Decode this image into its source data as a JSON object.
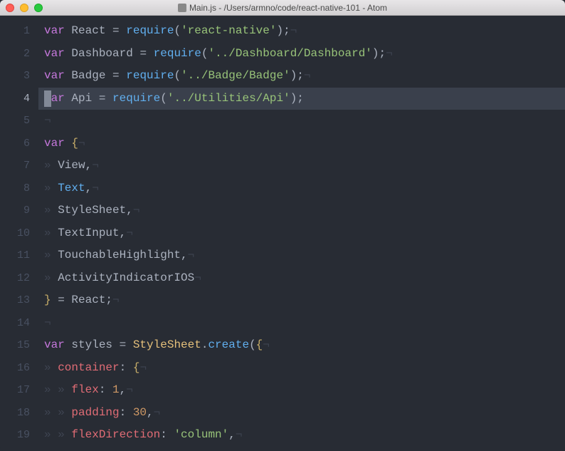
{
  "window": {
    "title": "Main.js - /Users/armno/code/react-native-101 - Atom"
  },
  "gutter": {
    "active_line": 4,
    "lines": [
      "1",
      "2",
      "3",
      "4",
      "5",
      "6",
      "7",
      "8",
      "9",
      "10",
      "11",
      "12",
      "13",
      "14",
      "15",
      "16",
      "17",
      "18",
      "19"
    ]
  },
  "code": {
    "lines": [
      {
        "n": 1,
        "t": [
          [
            "kw",
            "var"
          ],
          [
            "punct",
            " React "
          ],
          [
            "punct",
            "= "
          ],
          [
            "func",
            "require"
          ],
          [
            "punct",
            "("
          ],
          [
            "str",
            "'react-native'"
          ],
          [
            "punct",
            ");"
          ],
          [
            "invisible",
            "¬"
          ]
        ]
      },
      {
        "n": 2,
        "t": [
          [
            "kw",
            "var"
          ],
          [
            "punct",
            " Dashboard "
          ],
          [
            "punct",
            "= "
          ],
          [
            "func",
            "require"
          ],
          [
            "punct",
            "("
          ],
          [
            "str",
            "'../Dashboard/Dashboard'"
          ],
          [
            "punct",
            ");"
          ],
          [
            "invisible",
            "¬"
          ]
        ]
      },
      {
        "n": 3,
        "t": [
          [
            "kw",
            "var"
          ],
          [
            "punct",
            " Badge "
          ],
          [
            "punct",
            "= "
          ],
          [
            "func",
            "require"
          ],
          [
            "punct",
            "("
          ],
          [
            "str",
            "'../Badge/Badge'"
          ],
          [
            "punct",
            ");"
          ],
          [
            "invisible",
            "¬"
          ]
        ]
      },
      {
        "n": 4,
        "highlight": true,
        "cursor": true,
        "t": [
          [
            "kw",
            "var"
          ],
          [
            "punct",
            " Api "
          ],
          [
            "punct",
            "= "
          ],
          [
            "func",
            "require"
          ],
          [
            "punct",
            "("
          ],
          [
            "str",
            "'../Utilities/Api'"
          ],
          [
            "punct",
            ");"
          ]
        ]
      },
      {
        "n": 5,
        "t": [
          [
            "invisible",
            "¬"
          ]
        ]
      },
      {
        "n": 6,
        "t": [
          [
            "kw",
            "var"
          ],
          [
            "punct",
            " "
          ],
          [
            "brace",
            "{"
          ],
          [
            "invisible",
            "¬"
          ]
        ]
      },
      {
        "n": 7,
        "t": [
          [
            "invisible",
            "» "
          ],
          [
            "punct",
            "View,"
          ],
          [
            "invisible",
            "¬"
          ]
        ]
      },
      {
        "n": 8,
        "t": [
          [
            "invisible",
            "» "
          ],
          [
            "prop-blue",
            "Text"
          ],
          [
            "punct",
            ","
          ],
          [
            "invisible",
            "¬"
          ]
        ]
      },
      {
        "n": 9,
        "t": [
          [
            "invisible",
            "» "
          ],
          [
            "punct",
            "StyleSheet,"
          ],
          [
            "invisible",
            "¬"
          ]
        ]
      },
      {
        "n": 10,
        "t": [
          [
            "invisible",
            "» "
          ],
          [
            "punct",
            "TextInput,"
          ],
          [
            "invisible",
            "¬"
          ]
        ]
      },
      {
        "n": 11,
        "t": [
          [
            "invisible",
            "» "
          ],
          [
            "punct",
            "TouchableHighlight,"
          ],
          [
            "invisible",
            "¬"
          ]
        ]
      },
      {
        "n": 12,
        "t": [
          [
            "invisible",
            "» "
          ],
          [
            "punct",
            "ActivityIndicatorIOS"
          ],
          [
            "invisible",
            "¬"
          ]
        ]
      },
      {
        "n": 13,
        "t": [
          [
            "brace",
            "}"
          ],
          [
            "punct",
            " = React;"
          ],
          [
            "invisible",
            "¬"
          ]
        ]
      },
      {
        "n": 14,
        "t": [
          [
            "invisible",
            "¬"
          ]
        ]
      },
      {
        "n": 15,
        "t": [
          [
            "kw",
            "var"
          ],
          [
            "punct",
            " styles "
          ],
          [
            "punct",
            "= "
          ],
          [
            "styles-name",
            "StyleSheet"
          ],
          [
            "punct",
            "."
          ],
          [
            "func",
            "create"
          ],
          [
            "punct",
            "("
          ],
          [
            "brace",
            "{"
          ],
          [
            "invisible",
            "¬"
          ]
        ]
      },
      {
        "n": 16,
        "t": [
          [
            "invisible",
            "» "
          ],
          [
            "prop",
            "container"
          ],
          [
            "punct",
            ": "
          ],
          [
            "brace",
            "{"
          ],
          [
            "invisible",
            "¬"
          ]
        ]
      },
      {
        "n": 17,
        "t": [
          [
            "invisible",
            "» » "
          ],
          [
            "prop",
            "flex"
          ],
          [
            "punct",
            ": "
          ],
          [
            "num",
            "1"
          ],
          [
            "punct",
            ","
          ],
          [
            "invisible",
            "¬"
          ]
        ]
      },
      {
        "n": 18,
        "t": [
          [
            "invisible",
            "» » "
          ],
          [
            "prop",
            "padding"
          ],
          [
            "punct",
            ": "
          ],
          [
            "num",
            "30"
          ],
          [
            "punct",
            ","
          ],
          [
            "invisible",
            "¬"
          ]
        ]
      },
      {
        "n": 19,
        "t": [
          [
            "invisible",
            "» » "
          ],
          [
            "prop",
            "flexDirection"
          ],
          [
            "punct",
            ": "
          ],
          [
            "str",
            "'column'"
          ],
          [
            "punct",
            ","
          ],
          [
            "invisible",
            "¬"
          ]
        ]
      }
    ]
  }
}
